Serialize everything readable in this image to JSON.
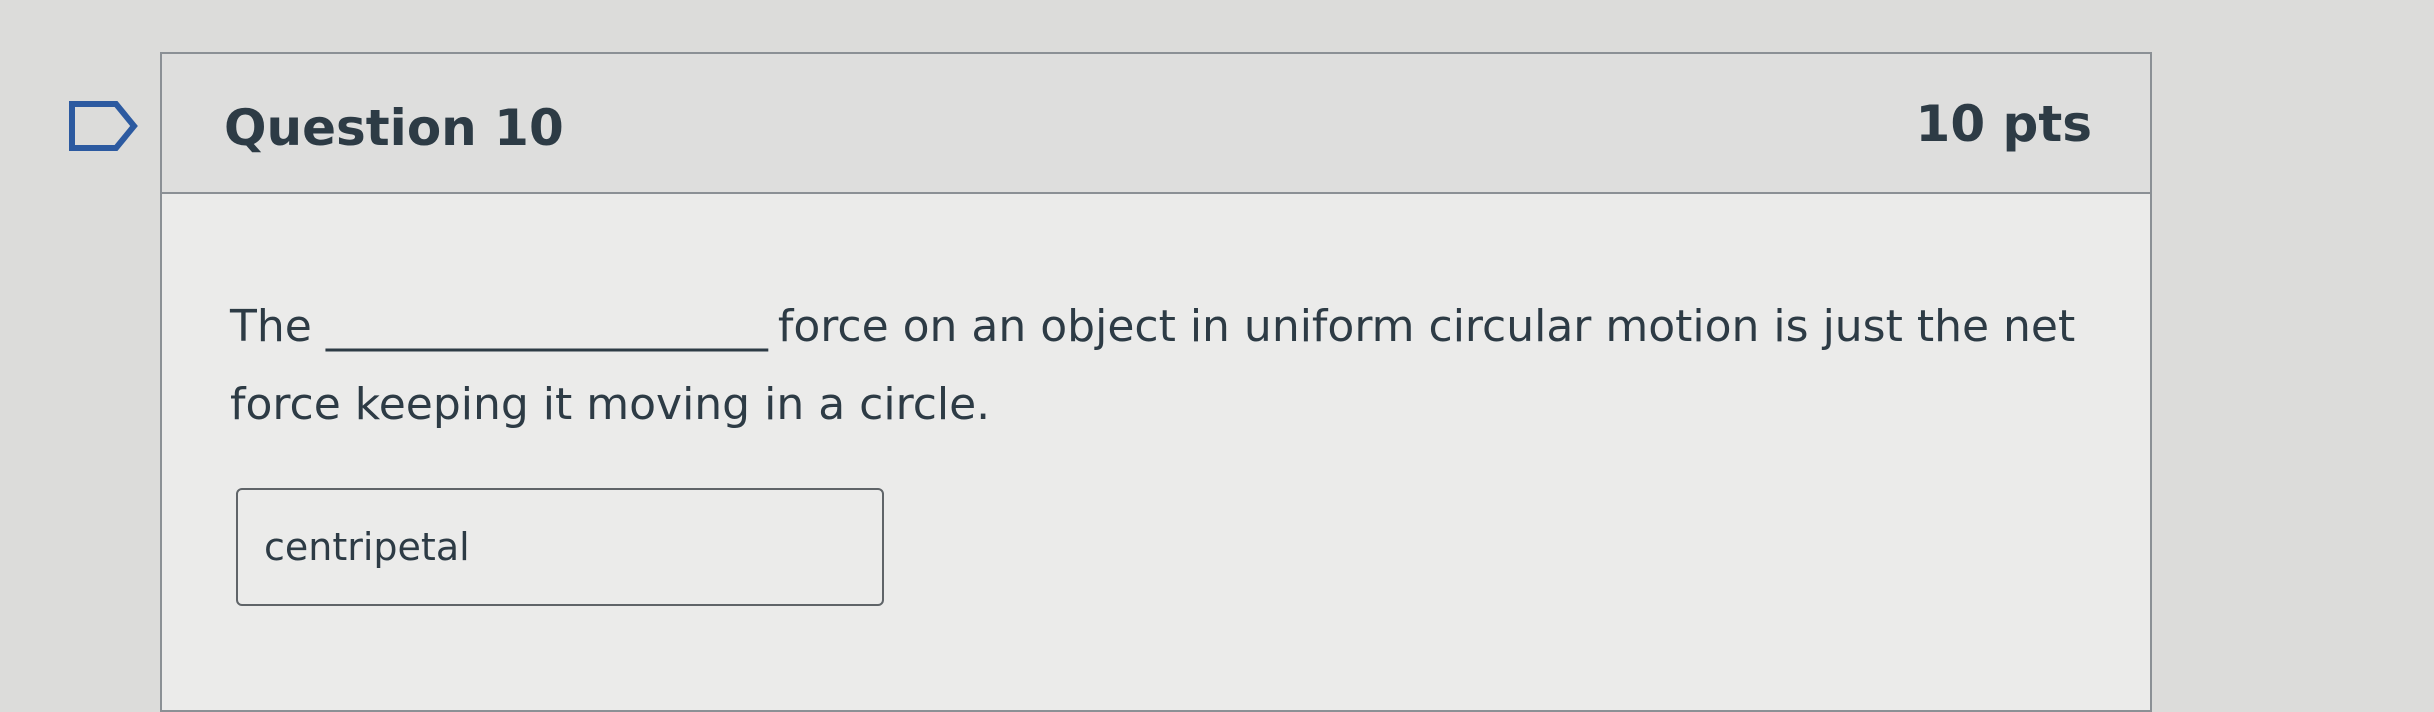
{
  "question": {
    "title": "Question 10",
    "points": "10 pts",
    "text_before_blank": "The",
    "blank": "______________________",
    "text_after_blank": "force on an object in uniform circular motion is just the net force keeping it moving in a circle.",
    "answer": "centripetal"
  },
  "icons": {
    "flag": "flag-question-icon"
  },
  "colors": {
    "background": "#dcdcda",
    "card_background": "#ebebea",
    "header_background": "#dededd",
    "border": "#8b9095",
    "text": "#2d3b45",
    "flag": "#2c5aa0"
  }
}
